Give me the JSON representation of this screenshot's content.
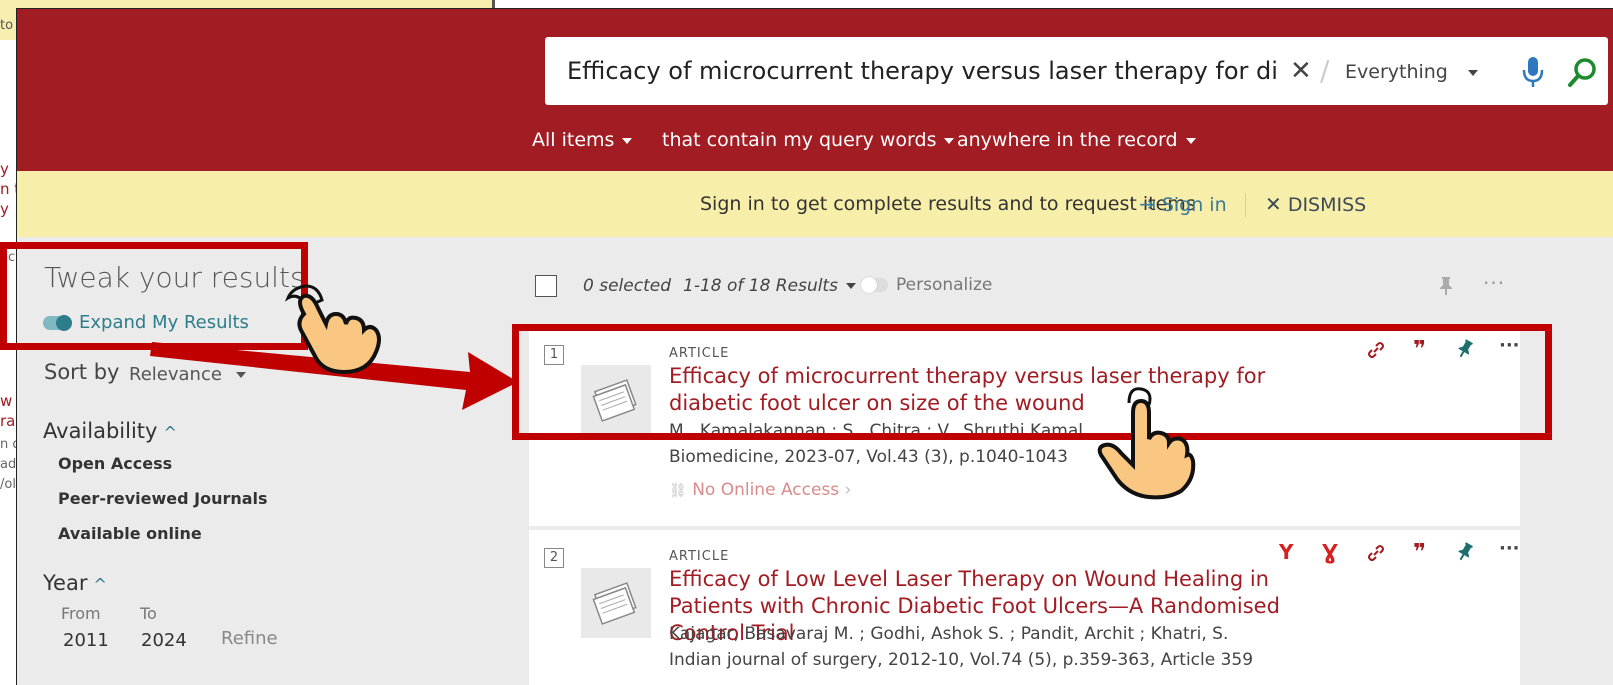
{
  "background_window": {
    "fragments": [
      "to",
      "y",
      "n t",
      "y",
      "oc",
      "w",
      "ra",
      "n d",
      "ad",
      "/ol."
    ]
  },
  "search": {
    "query": "Efficacy of microcurrent therapy versus laser therapy for diabetic f",
    "scope": "Everything",
    "clear_icon": "close-icon",
    "mic_icon": "microphone-icon",
    "submit_icon": "search-icon"
  },
  "filters": {
    "items": "All items",
    "match": "that contain my query words",
    "field": "anywhere in the record"
  },
  "banner": {
    "message": "Sign in to get complete results and to request items",
    "signin": "Sign in",
    "dismiss": "DISMISS"
  },
  "sidebar": {
    "title": "Tweak your results",
    "expand_label": "Expand My Results",
    "sort_label": "Sort by",
    "sort_value": "Relevance",
    "availability_title": "Availability",
    "availability_items": [
      "Open Access",
      "Peer-reviewed Journals",
      "Available online"
    ],
    "year_title": "Year",
    "from_label": "From",
    "to_label": "To",
    "from_value": "2011",
    "to_value": "2024",
    "refine_label": "Refine"
  },
  "results_header": {
    "selected": "0 selected",
    "count": "1-18 of 18 Results",
    "personalize": "Personalize"
  },
  "results": [
    {
      "number": "1",
      "type": "ARTICLE",
      "title": "Efficacy of microcurrent therapy versus laser therapy for diabetic foot ulcer on size of the wound",
      "authors": "M., Kamalakannan ; S., Chitra ; V., Shruthi Kamal",
      "source": "Biomedicine, 2023-07, Vol.43 (3), p.1040-1043",
      "access": "No Online Access"
    },
    {
      "number": "2",
      "type": "ARTICLE",
      "title": "Efficacy of Low Level Laser Therapy on Wound Healing in Patients with Chronic Diabetic Foot Ulcers—A Randomised Control Trial",
      "authors": "Kajagar, Basavaraj M. ; Godhi, Ashok S. ; Pandit, Archit ; Khatri, S.",
      "source": "Indian journal of surgery, 2012-10, Vol.74 (5), p.359-363, Article 359"
    }
  ],
  "colors": {
    "brand_red": "#a21c23",
    "banner_yellow": "#f7eeaa",
    "teal": "#2e7d8a",
    "annotation_red": "#c00000"
  }
}
